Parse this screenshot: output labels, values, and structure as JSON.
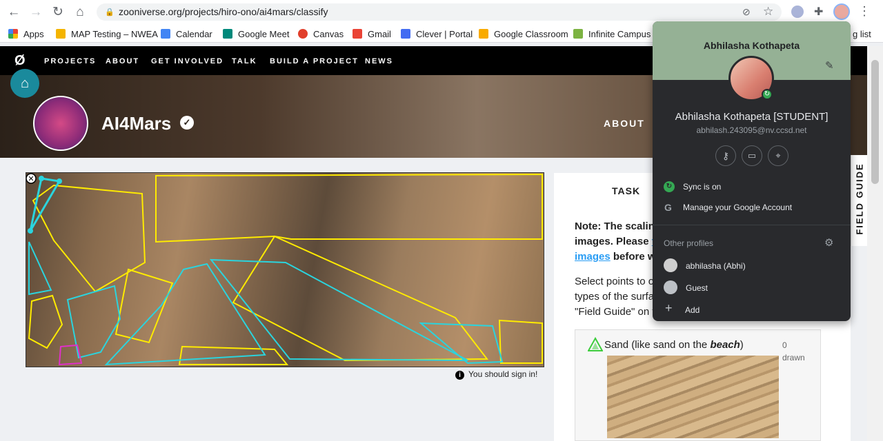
{
  "browser": {
    "url": "zooniverse.org/projects/hiro-ono/ai4mars/classify",
    "bookmarks": [
      "Apps",
      "MAP Testing – NWEA",
      "Calendar",
      "Google Meet",
      "Canvas",
      "Gmail",
      "Clever | Portal",
      "Google Classroom",
      "Infinite Campus"
    ],
    "bookmark_overflow": "g list"
  },
  "site": {
    "nav": [
      "PROJECTS",
      "ABOUT",
      "GET INVOLVED",
      "TALK",
      "BUILD A PROJECT",
      "NEWS"
    ],
    "project_title": "AI4Mars",
    "about": "ABOUT",
    "sign_in_notice": "You should sign in!"
  },
  "task": {
    "tab": "TASK",
    "note_line1": "Note: The scalin",
    "note_line2_a": "images. Please ",
    "note_line2_link": "t",
    "note_line3_link": "images",
    "note_line3_b": " before w",
    "instr1": "Select points to o",
    "instr2": "types of the surfa",
    "instr3": "\"Field Guide\" on t",
    "sand_label_a": "Sand (like sand on the ",
    "sand_label_em": "beach",
    "sand_label_b": ")",
    "sand_count": "0",
    "sand_drawn": "drawn"
  },
  "field_guide": "FIELD GUIDE",
  "profile": {
    "name": "Abhilasha Kothapeta",
    "full_name": "Abhilasha Kothapeta [STUDENT]",
    "email": "abhilash.243095@nv.ccsd.net",
    "sync": "Sync is on",
    "manage": "Manage your Google Account",
    "other_profiles": "Other profiles",
    "profiles": [
      "abhilasha (Abhi)",
      "Guest"
    ],
    "add": "Add"
  }
}
